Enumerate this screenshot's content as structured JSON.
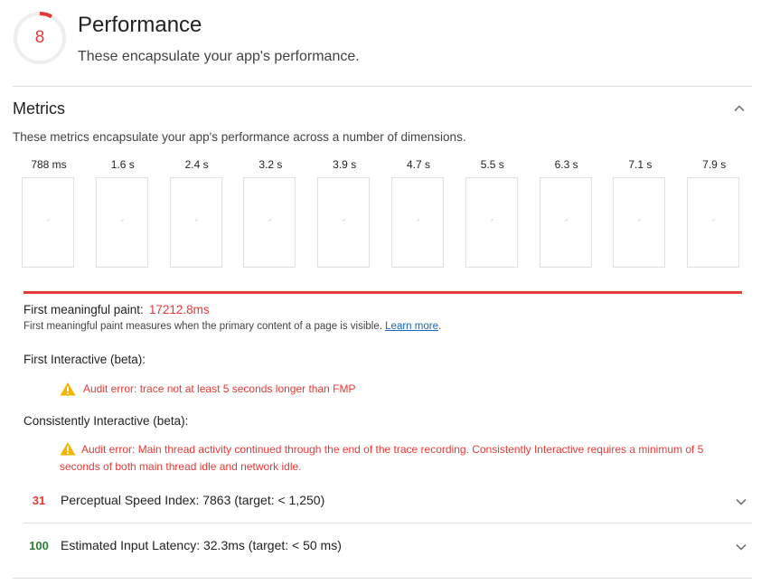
{
  "category": {
    "score": "8",
    "score_fraction": 0.08,
    "title": "Performance",
    "description": "These encapsulate your app's performance."
  },
  "metrics": {
    "title": "Metrics",
    "description": "These metrics encapsulate your app's performance across a number of dimensions.",
    "filmstrip": [
      "788 ms",
      "1.6 s",
      "2.4 s",
      "3.2 s",
      "3.9 s",
      "4.7 s",
      "5.5 s",
      "6.3 s",
      "7.1 s",
      "7.9 s"
    ]
  },
  "fmp": {
    "label": "First meaningful paint:",
    "value": "17212.8ms",
    "help": "First meaningful paint measures when the primary content of a page is visible.",
    "learn_more": "Learn more",
    "help_end": "."
  },
  "first_interactive": {
    "label": "First Interactive (beta):",
    "error": "Audit error: trace not at least 5 seconds longer than FMP"
  },
  "consistently_interactive": {
    "label": "Consistently Interactive (beta):",
    "error": "Audit error: Main thread activity continued through the end of the trace recording. Consistently Interactive requires a minimum of 5 seconds of both main thread idle and network idle."
  },
  "audits": [
    {
      "score": "31",
      "text": "Perceptual Speed Index: 7863 (target: < 1,250)",
      "status_color": "#e53935"
    },
    {
      "score": "100",
      "text": "Estimated Input Latency: 32.3ms (target: < 50 ms)",
      "status_color": "#2e7d32"
    }
  ],
  "icons": {
    "warning": "warning-triangle-icon",
    "collapse": "chevron-up-icon",
    "expand": "chevron-down-icon"
  },
  "colors": {
    "fail": "#e53935",
    "pass": "#2e7d32",
    "link": "#1565c0",
    "warning": "#f4b400"
  }
}
